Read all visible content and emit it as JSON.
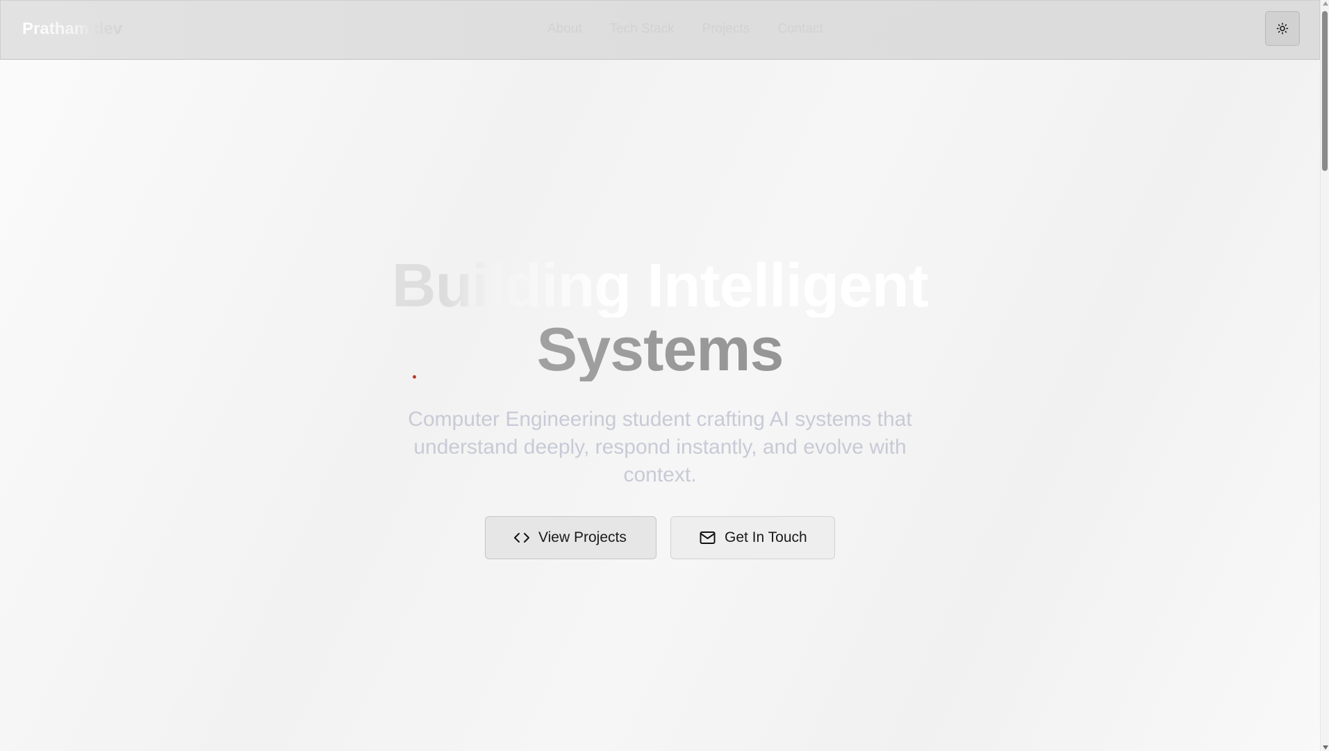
{
  "navbar": {
    "brand": "Pratham.dev",
    "links": [
      "About",
      "Tech Stack",
      "Projects",
      "Contact"
    ],
    "theme_toggle_icon": "sun-icon"
  },
  "hero": {
    "title_line_1": "Building Intelligent",
    "title_line_2": "Systems",
    "subtitle": "Computer Engineering student crafting AI systems that understand deeply, respond instantly, and evolve with context.",
    "buttons": [
      {
        "label": "View Projects",
        "icon": "code-icon"
      },
      {
        "label": "Get In Touch",
        "icon": "mail-icon"
      }
    ]
  },
  "colors": {
    "cursor_dot": "#c0392b",
    "subtitle_text": "#c8cad6",
    "nav_link_text": "#d2d2d2"
  }
}
